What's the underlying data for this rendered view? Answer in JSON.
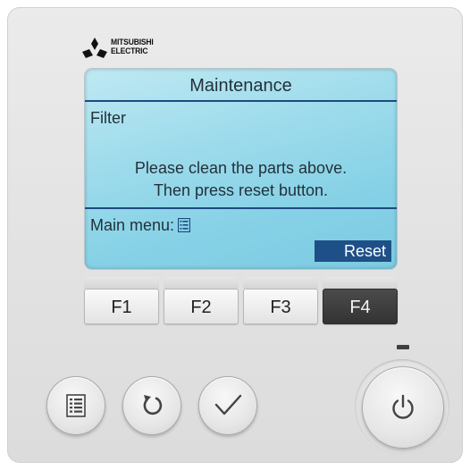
{
  "brand": {
    "line1": "MITSUBISHI",
    "line2": "ELECTRIC"
  },
  "screen": {
    "title": "Maintenance",
    "item": "Filter",
    "message_line1": "Please clean the parts above.",
    "message_line2": "Then press reset button.",
    "main_menu_label": "Main menu:",
    "reset_label": "Reset"
  },
  "function_keys": [
    "F1",
    "F2",
    "F3",
    "F4"
  ],
  "buttons": {
    "menu": "menu-icon",
    "return": "return-arrow-icon",
    "confirm": "checkmark-icon",
    "power": "power-icon"
  },
  "colors": {
    "lcd": "#9fdcec",
    "lcd_rule": "#1d4a7e",
    "reset_bg": "#1f4f87",
    "f4_active": "#3a3a3a",
    "panel": "#e4e4e4"
  }
}
